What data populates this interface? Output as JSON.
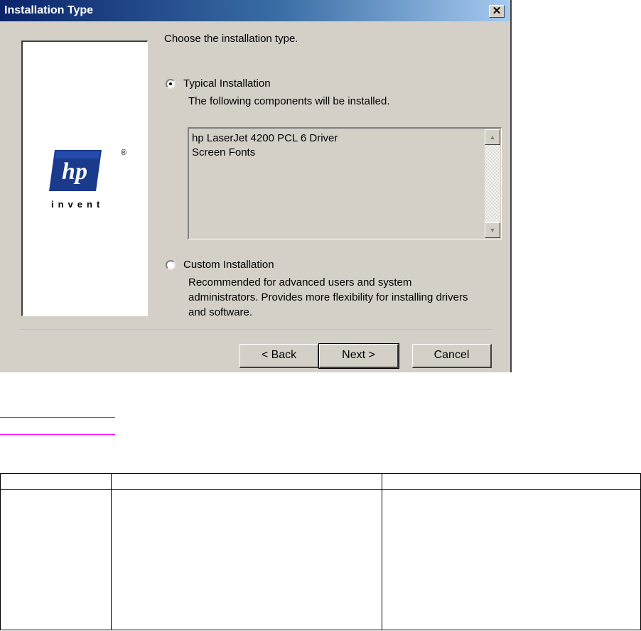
{
  "dialog": {
    "title": "Installation Type",
    "close_label": "✕",
    "logo": {
      "text": "hp",
      "tagline": "invent",
      "registered_mark": "®",
      "color": "#1a3a8c"
    },
    "prompt": "Choose the installation type.",
    "typical": {
      "label": "Typical Installation",
      "selected": true,
      "description": "The following components will be installed.",
      "components": [
        "hp LaserJet 4200 PCL 6 Driver",
        "Screen Fonts"
      ]
    },
    "custom": {
      "label": "Custom Installation",
      "selected": false,
      "description_lines": [
        "Recommended for advanced users and system",
        "administrators.  Provides more flexibility for installing drivers",
        "and software."
      ]
    },
    "scroll_up": "▲",
    "scroll_down": "▼",
    "buttons": {
      "back": "< Back",
      "next": "Next >",
      "cancel": "Cancel"
    }
  },
  "colors": {
    "dialog_bg": "#d4d0c8",
    "title_bar": "#0a246a",
    "link_underline": "#ff00ff"
  }
}
